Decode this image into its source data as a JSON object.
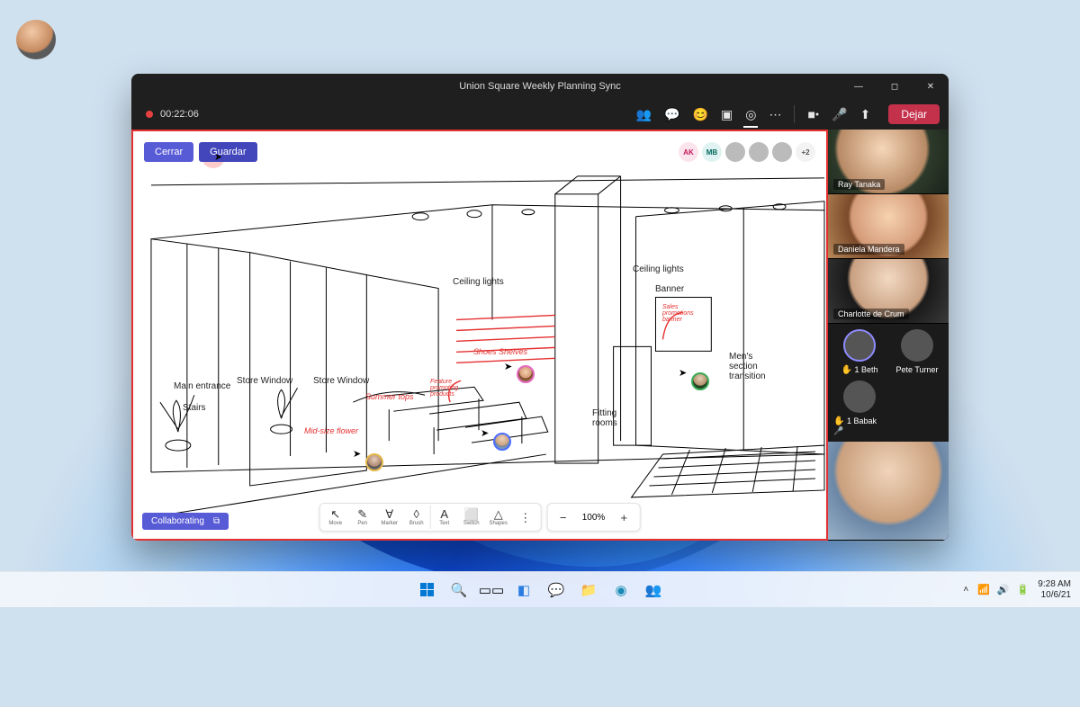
{
  "window": {
    "title": "Union Square Weekly Planning Sync",
    "recording_time": "00:22:06",
    "leave_label": "Dejar"
  },
  "meetbar_icons": [
    "people",
    "chat",
    "reactions",
    "rooms",
    "live",
    "more",
    "camera",
    "mic",
    "share"
  ],
  "canvas": {
    "close_label": "Cerrar",
    "save_label": "Guardar",
    "status_label": "Collaborating",
    "zoom_value": "100%",
    "tools": [
      {
        "icon": "↖",
        "label": "Move"
      },
      {
        "icon": "✎",
        "label": "Pen"
      },
      {
        "icon": "∀",
        "label": "Marker"
      },
      {
        "icon": "◊",
        "label": "Brush"
      },
      {
        "icon": "A",
        "label": "Text"
      },
      {
        "icon": "⬜",
        "label": "Switch"
      },
      {
        "icon": "△",
        "label": "Shapes"
      }
    ],
    "labels": {
      "main_entrance": "Main entrance",
      "stairs": "Stairs",
      "store_window_1": "Store Window",
      "store_window_2": "Store Window",
      "ceiling_1": "Ceiling lights",
      "ceiling_2": "Ceiling lights",
      "banner": "Banner",
      "mens": "Men's section transition",
      "fitting": "Fitting rooms"
    },
    "annotations": {
      "midsize_flower": "Mid-size flower",
      "summer_tops": "Summer tops",
      "shoes_shelves": "Shoes Shelves",
      "featured_products": "Feature promoting products",
      "sales_banner": "Sales promotions banner"
    },
    "avatars": {
      "chips": [
        "AK",
        "MB"
      ],
      "more": "+2"
    }
  },
  "participants": {
    "large": [
      {
        "name": "Ray Tanaka"
      },
      {
        "name": "Daniela Mandera"
      },
      {
        "name": "Charlotte de Crum"
      }
    ],
    "small": [
      {
        "name": "Beth",
        "raised": "1",
        "mic": ""
      },
      {
        "name": "Pete Turner"
      },
      {
        "name": "Babak",
        "raised": "1",
        "mic": "🎤"
      }
    ]
  },
  "taskbar": {
    "time": "9:28 AM",
    "date": "10/6/21"
  }
}
